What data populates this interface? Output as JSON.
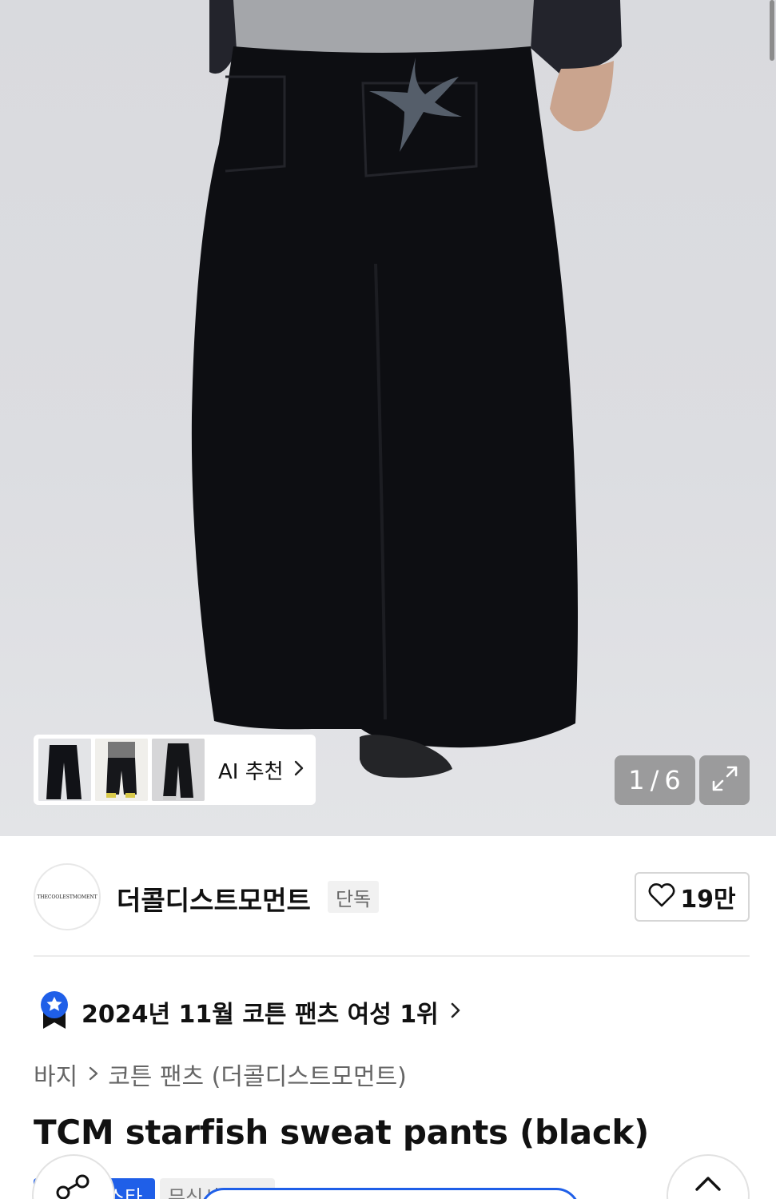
{
  "gallery": {
    "current": "1",
    "separator": "/",
    "total": "6",
    "recommend_label": "AI 추천",
    "thumbnails": [
      "thumbnail-1",
      "thumbnail-2",
      "thumbnail-3"
    ]
  },
  "brand": {
    "logo_text": "THECOOLESTMOMENT",
    "name": "더콜디스트모먼트",
    "badge": "단독",
    "like_count": "19만"
  },
  "ranking": {
    "text": "2024년 11월 코튼 팬츠 여성 1위"
  },
  "breadcrumb": {
    "category": "바지",
    "subcategory": "코튼 팬츠 (더콜디스트모먼트)"
  },
  "product": {
    "title": "TCM starfish sweat pants (black)"
  },
  "tags": {
    "blue": "스타",
    "gray": "무신사 단독"
  },
  "colors": {
    "accent": "#1f5fe8",
    "text": "#111111",
    "muted": "#666666"
  }
}
